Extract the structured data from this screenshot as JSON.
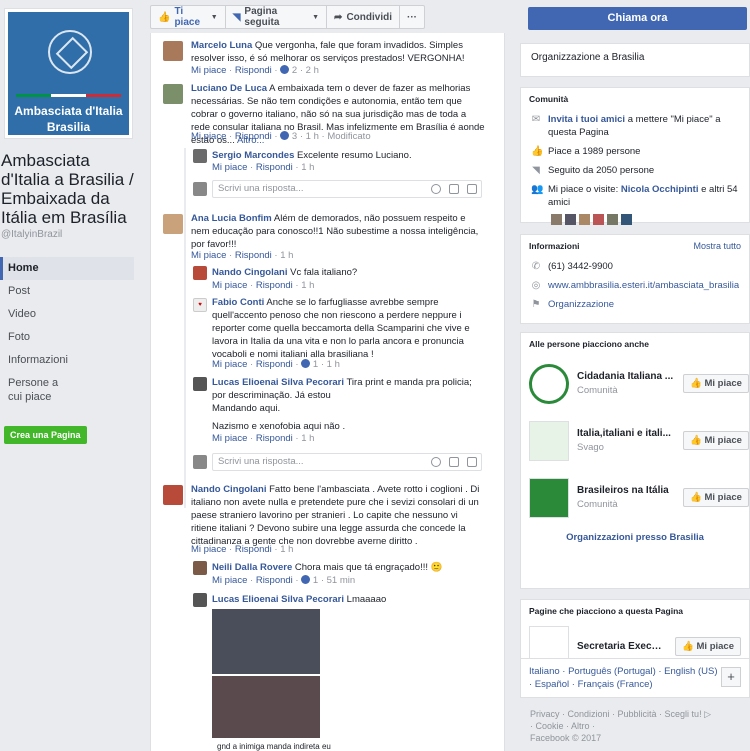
{
  "page": {
    "cover_title_1": "Ambasciata d'Italia",
    "cover_title_2": "Brasilia",
    "name": "Ambasciata d'Italia a Brasilia / Embaixada da Itália em Brasília",
    "handle": "@ItalyinBrazil"
  },
  "nav": [
    "Home",
    "Post",
    "Video",
    "Foto",
    "Informazioni",
    "Persone a cui piace"
  ],
  "create_page_label": "Crea una Pagina",
  "actions": {
    "like": "Ti piace",
    "follow": "Pagina seguita",
    "share": "Condividi",
    "more": "···",
    "call_now": "Chiama ora"
  },
  "comments": [
    {
      "author": "Marcelo Luna",
      "text": "Que vergonha, fale que foram invadidos. Simples resolver isso, é só melhorar os serviços prestados! VERGONHA!",
      "meta_like": "Mi piace",
      "meta_reply": "Rispondi",
      "reactions": "2",
      "time": "2 h"
    },
    {
      "author": "Luciano De Luca",
      "text": "A embaixada tem o dever de fazer as melhorias necessárias. Se não tem condições e autonomia, então tem que cobrar o governo italiano, não só na sua jurisdição mas de toda a rede consular italiana no Brasil. Mas infelizmente em Brasília é aonde estão os...",
      "more": "Altro...",
      "meta_like": "Mi piace",
      "meta_reply": "Rispondi",
      "reactions": "3",
      "time": "1 h",
      "edited": "Modificato"
    },
    {
      "author": "Sergio Marcondes",
      "text": "Excelente resumo Luciano.",
      "meta_like": "Mi piace",
      "meta_reply": "Rispondi",
      "time": "1 h"
    },
    {
      "author": "Ana Lucia Bonfim",
      "text": "Além de demorados, não possuem respeito e nem educação para conosco!!1 Não subestime a nossa inteligência, por favor!!!",
      "meta_like": "Mi piace",
      "meta_reply": "Rispondi",
      "time": "1 h"
    },
    {
      "author": "Nando Cingolani",
      "text": "Vc fala italiano?",
      "meta_like": "Mi piace",
      "meta_reply": "Rispondi",
      "time": "1 h"
    },
    {
      "author": "Fabio Conti",
      "text": "Anche se lo farfugliasse avrebbe sempre quell'accento penoso che non riescono a perdere neppure i reporter come quella beccamorta della Scamparini che vive e lavora in Italia da una vita e non lo parla ancora e pronuncia vocaboli e nomi italiani alla brasiliana !",
      "meta_like": "Mi piace",
      "meta_reply": "Rispondi",
      "reactions": "1",
      "time": "1 h"
    },
    {
      "author": "Lucas Elioenai Silva Pecorari",
      "text": "Tira print e manda pra policia; por descriminação. Já estou",
      "text2": "Mandando aqui.",
      "text3": "Nazismo e xenofobia aqui não .",
      "meta_like": "Mi piace",
      "meta_reply": "Rispondi",
      "time": "1 h"
    },
    {
      "author": "Nando Cingolani",
      "text": "Fatto bene l'ambasciata . Avete rotto i coglioni . Di italiano non avete nulla e pretendete pure che i sevizi consolari di un paese straniero lavorino per stranieri . Lo capite che nessuno vi ritiene italiani ? Devono subire una legge assurda che concede la cittadinanza a gente che non dovrebbe averne diritto .",
      "meta_like": "Mi piace",
      "meta_reply": "Rispondi",
      "time": "1 h"
    },
    {
      "author": "Neili Dalla Rovere",
      "text": "Chora mais que tá engraçado!!! 🙂",
      "meta_like": "Mi piace",
      "meta_reply": "Rispondi",
      "reactions": "1",
      "time": "51 min"
    },
    {
      "author": "Lucas Elioenai Silva Pecorari",
      "text": "Lmaaaao",
      "caption": "gnd a inimiga manda indireta eu"
    }
  ],
  "reply_placeholder": "Scrivi una risposta...",
  "right": {
    "category": "Organizzazione a Brasilia",
    "community_header": "Comunità",
    "invite_link": "Invita i tuoi amici",
    "invite_text": "a mettere \"Mi piace\" a questa Pagina",
    "likes": "Piace a 1989 persone",
    "follows": "Seguito da 2050 persone",
    "friends_prefix": "Mi piace o visite:",
    "friends_name": "Nicola Occhipinti",
    "friends_suffix": "e altri 54 amici",
    "info_header": "Informazioni",
    "info_more": "Mostra tutto",
    "phone": "(61) 3442-9900",
    "website": "www.ambbrasilia.esteri.it/ambasciata_brasilia/it",
    "category_link": "Organizzazione",
    "also_like_header": "Alle persone piacciono anche",
    "pages": [
      {
        "name": "Cidadania Italiana ...",
        "sub": "Comunità",
        "btn": "Mi piace"
      },
      {
        "name": "Italia,italiani e itali...",
        "sub": "Svago",
        "btn": "Mi piace"
      },
      {
        "name": "Brasileiros na Itália",
        "sub": "Comunità",
        "btn": "Mi piace"
      }
    ],
    "also_like_footer": "Organizzazioni presso Brasilia",
    "liked_by_page_header": "Pagine che piacciono a questa Pagina",
    "liked_page": {
      "name": "Secretaria Executi...",
      "btn": "Mi piace"
    },
    "languages_line1": "Italiano · Português (Portugal) · English (US)",
    "languages_line2": "· Español · Français (France)",
    "lang_plus": "+",
    "footer_line1": "Privacy · Condizioni · Pubblicità · Scegli tu! ▷",
    "footer_line2": "· Cookie · Altro ·",
    "footer_line3": "Facebook © 2017"
  },
  "colors": {
    "fb_blue": "#4267b2",
    "link": "#365899",
    "bg": "#e9ebee",
    "green": "#42b72a"
  }
}
